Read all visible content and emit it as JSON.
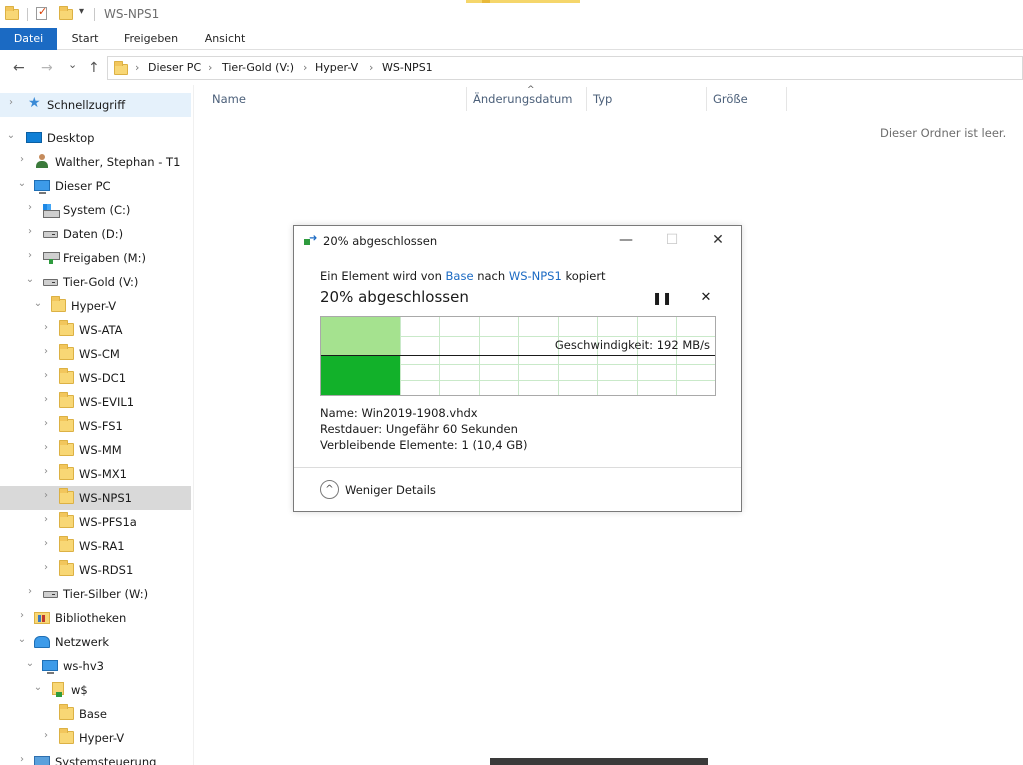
{
  "window": {
    "title": "WS-NPS1",
    "quick_access_dropdown": "▾"
  },
  "ribbon": {
    "tabs": [
      "Datei",
      "Start",
      "Freigeben",
      "Ansicht"
    ]
  },
  "nav": {
    "back": "←",
    "forward": "→",
    "recent": "⌄",
    "up": "↑",
    "breadcrumb": [
      "Dieser PC",
      "Tier-Gold (V:)",
      "Hyper-V",
      "WS-NPS1"
    ],
    "separator": "›"
  },
  "sidebar": {
    "items": [
      {
        "label": "Schnellzugriff",
        "icon": "star-icon"
      },
      {
        "label": "Desktop",
        "icon": "desktop-icon"
      },
      {
        "label": "Walther, Stephan - T1",
        "icon": "user-icon"
      },
      {
        "label": "Dieser PC",
        "icon": "computer-icon"
      },
      {
        "label": "System (C:)",
        "icon": "system-drive-icon"
      },
      {
        "label": "Daten (D:)",
        "icon": "drive-icon"
      },
      {
        "label": "Freigaben (M:)",
        "icon": "network-drive-icon"
      },
      {
        "label": "Tier-Gold (V:)",
        "icon": "drive-icon"
      },
      {
        "label": "Hyper-V",
        "icon": "folder-icon"
      },
      {
        "label": "WS-ATA",
        "icon": "folder-icon"
      },
      {
        "label": "WS-CM",
        "icon": "folder-icon"
      },
      {
        "label": "WS-DC1",
        "icon": "folder-icon"
      },
      {
        "label": "WS-EVIL1",
        "icon": "folder-icon"
      },
      {
        "label": "WS-FS1",
        "icon": "folder-icon"
      },
      {
        "label": "WS-MM",
        "icon": "folder-icon"
      },
      {
        "label": "WS-MX1",
        "icon": "folder-icon"
      },
      {
        "label": "WS-NPS1",
        "icon": "folder-icon"
      },
      {
        "label": "WS-PFS1a",
        "icon": "folder-icon"
      },
      {
        "label": "WS-RA1",
        "icon": "folder-icon"
      },
      {
        "label": "WS-RDS1",
        "icon": "folder-icon"
      },
      {
        "label": "Tier-Silber (W:)",
        "icon": "drive-icon"
      },
      {
        "label": "Bibliotheken",
        "icon": "library-icon"
      },
      {
        "label": "Netzwerk",
        "icon": "network-icon"
      },
      {
        "label": "ws-hv3",
        "icon": "computer-icon"
      },
      {
        "label": "w$",
        "icon": "share-folder-icon"
      },
      {
        "label": "Base",
        "icon": "folder-icon"
      },
      {
        "label": "Hyper-V",
        "icon": "folder-icon"
      },
      {
        "label": "Systemsteuerung",
        "icon": "control-panel-icon"
      }
    ]
  },
  "columns": {
    "name": "Name",
    "modified": "Änderungsdatum",
    "type": "Typ",
    "size": "Größe",
    "sort_indicator": "^"
  },
  "content": {
    "empty_text": "Dieser Ordner ist leer."
  },
  "copy_dialog": {
    "title": "20% abgeschlossen",
    "minimize": "—",
    "maximize": "☐",
    "close": "✕",
    "desc_prefix": "Ein Element wird von",
    "source": "Base",
    "desc_mid": "nach",
    "destination": "WS-NPS1",
    "desc_suffix": "kopiert",
    "heading": "20% abgeschlossen",
    "pause": "❚❚",
    "cancel": "✕",
    "progress_fraction": 0.2,
    "speed_text": "Geschwindigkeit: 192 MB/s",
    "name_label": "Name:",
    "name_value": "Win2019-1908.vhdx",
    "remaining_label": "Restdauer:",
    "remaining_value": "Ungefähr 60 Sekunden",
    "items_label": "Verbleibende Elemente:",
    "items_value": "1 (10,4 GB)",
    "less_details": "Weniger Details",
    "less_details_icon": "^"
  },
  "colors": {
    "accent": "#1b6ac3",
    "progress_light": "#a5e28f",
    "progress_dark": "#12b12a"
  }
}
